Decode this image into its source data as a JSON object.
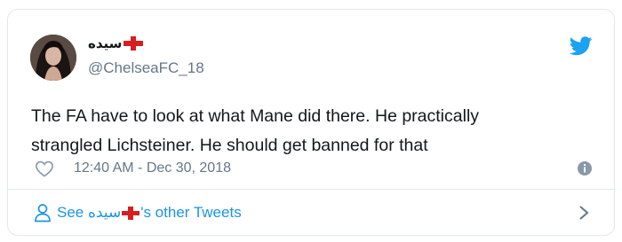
{
  "user": {
    "display_name": "سيده",
    "handle": "@ChelseaFC_18"
  },
  "tweet": {
    "text_line1": "The FA have to look at what Mane did there. He practically",
    "text_line2": "strangled Lichsteiner. He should get banned for that",
    "timestamp": "12:40 AM - Dec 30, 2018"
  },
  "footer": {
    "see_label": "See",
    "name": "سيده",
    "suffix": "'s other Tweets"
  },
  "colors": {
    "twitter_blue": "#1da1f2",
    "link_blue": "#1b95e0",
    "muted": "#657786",
    "flag_red": "#d42020"
  },
  "icons": [
    "twitter-bird-icon",
    "heart-icon",
    "info-icon",
    "person-icon",
    "chevron-right-icon",
    "england-flag-icon"
  ]
}
